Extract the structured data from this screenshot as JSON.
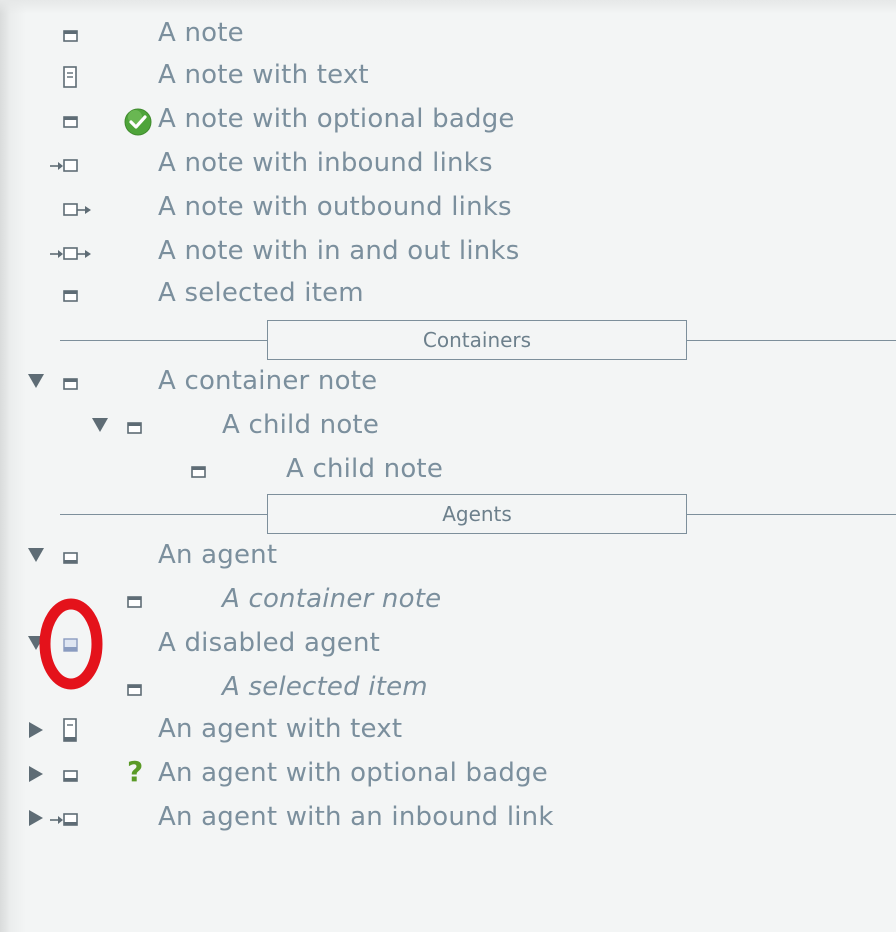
{
  "items": {
    "note": "A note",
    "note_text": "A note with text",
    "note_badge": "A note with optional badge",
    "note_inbound": "A note with inbound links",
    "note_outbound": "A note with outbound links",
    "note_inout": "A note with in and out links",
    "selected": "A selected item",
    "container": "A container note",
    "child1": "A child note",
    "child2": "A child note",
    "agent": "An agent",
    "agent_child": "A container note",
    "disabled_agent": "A disabled agent",
    "disabled_child": "A selected item",
    "agent_text": "An agent with text",
    "agent_badge": "An agent with optional badge",
    "agent_inbound": "An agent with an inbound link"
  },
  "sections": {
    "containers": "Containers",
    "agents": "Agents"
  },
  "badges": {
    "check": "checkmark-badge-icon",
    "question": "?"
  },
  "colors": {
    "text": "#7b8f9d",
    "icon": "#5e6c75",
    "check_green": "#4ea43a",
    "question_green": "#5a9a26",
    "annotation_red": "#e4121b"
  }
}
